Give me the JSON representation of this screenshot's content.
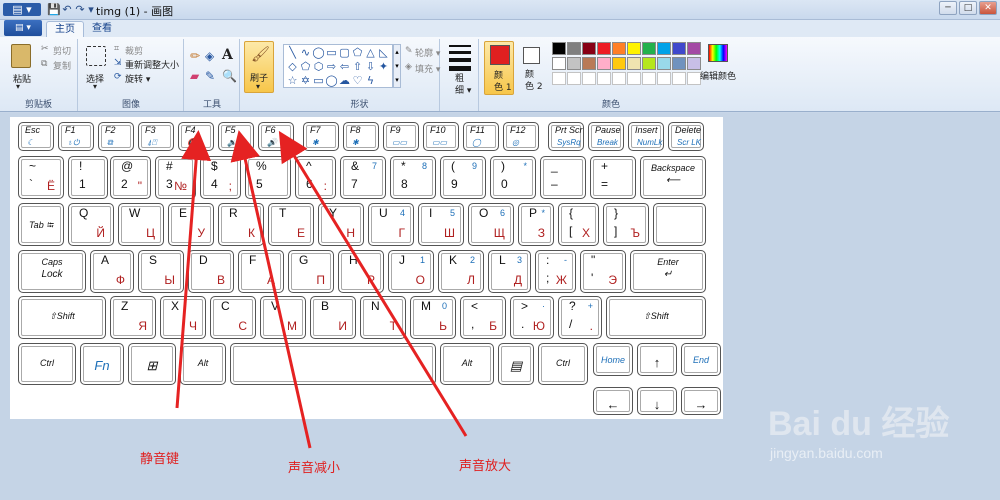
{
  "window": {
    "title": "timg (1) - 画图",
    "app_menu": "▤ ▾",
    "quick_access": [
      "💾",
      "↶",
      "↷",
      "▾"
    ],
    "controls": {
      "minimize": "─",
      "maximize": "□",
      "close": "✕"
    }
  },
  "tabs": [
    {
      "label": "主页",
      "active": true
    },
    {
      "label": "查看",
      "active": false
    }
  ],
  "ribbon": {
    "clipboard": {
      "paste": "粘贴",
      "cut": "剪切",
      "copy": "复制",
      "group": "剪贴板"
    },
    "image": {
      "select": "选择",
      "crop": "裁剪",
      "resize": "重新调整大小",
      "rotate": "旋转 ▾",
      "group": "图像"
    },
    "tools": {
      "group": "工具"
    },
    "brushes": {
      "label": "刷子"
    },
    "shapes": {
      "outline": "轮廓 ▾",
      "fill": "填充 ▾",
      "group": "形状"
    },
    "size": {
      "label": "粗\n细 ▾"
    },
    "colors": {
      "color1": "颜\n色 1",
      "color2": "颜\n色 2",
      "edit": "编辑颜色",
      "group": "颜色",
      "color1_value": "#e02020",
      "color2_value": "#ffffff",
      "palette_row1": [
        "#000000",
        "#7f7f7f",
        "#880015",
        "#ed1c24",
        "#ff7f27",
        "#fff200",
        "#22b14c",
        "#00a2e8",
        "#3f48cc",
        "#a349a4"
      ],
      "palette_row2": [
        "#ffffff",
        "#c3c3c3",
        "#b97a57",
        "#ffaec9",
        "#ffc90e",
        "#efe4b0",
        "#b5e61d",
        "#99d9ea",
        "#7092be",
        "#c8bfe7"
      ]
    }
  },
  "keyboard": {
    "rows": [
      [
        {
          "t": "Esc",
          "b": "☾"
        },
        {
          "t": "F1",
          "b": "♁⏻"
        },
        {
          "t": "F2",
          "b": "⧉"
        },
        {
          "t": "F3",
          "b": "⍋⍞"
        },
        {
          "t": "F4",
          "b": "🔇"
        },
        {
          "t": "F5",
          "b": "🔉"
        },
        {
          "t": "F6",
          "b": "🔊"
        },
        {
          "t": "F7",
          "b": "✱"
        },
        {
          "t": "F8",
          "b": "✱"
        },
        {
          "t": "F9",
          "b": "▭▭"
        },
        {
          "t": "F10",
          "b": "▭▭"
        },
        {
          "t": "F11",
          "b": "◯"
        },
        {
          "t": "F12",
          "b": "◎"
        },
        {
          "t": "Prt Scr",
          "b": "SysRq"
        },
        {
          "t": "Pause",
          "b": "Break"
        },
        {
          "t": "Insert",
          "b": "NumLk"
        },
        {
          "t": "Delete",
          "b": "Scr LK"
        }
      ],
      [
        {
          "t": "~",
          "b": "`",
          "r": "Ё"
        },
        {
          "t": "!",
          "b": "1"
        },
        {
          "t": "@",
          "b": "2",
          "r": "\""
        },
        {
          "t": "#",
          "b": "3",
          "r": "№"
        },
        {
          "t": "$",
          "b": "4",
          "r": ";"
        },
        {
          "t": "%",
          "b": "5"
        },
        {
          "t": "^",
          "b": "6",
          "r": ":"
        },
        {
          "t": "&",
          "b": "7",
          "n": "7"
        },
        {
          "t": "*",
          "b": "8",
          "n": "8"
        },
        {
          "t": "(",
          "b": "9",
          "n": "9"
        },
        {
          "t": ")",
          "b": "0",
          "n": "*"
        },
        {
          "t": "_",
          "b": "–"
        },
        {
          "t": "+",
          "b": "="
        },
        {
          "t": "Backspace",
          "b": "⟵"
        }
      ],
      [
        {
          "t": "Tab ⭾"
        },
        {
          "t": "Q",
          "r": "Й"
        },
        {
          "t": "W",
          "r": "Ц"
        },
        {
          "t": "E",
          "r": "У"
        },
        {
          "t": "R",
          "r": "К"
        },
        {
          "t": "T",
          "r": "Е"
        },
        {
          "t": "Y",
          "r": "Н"
        },
        {
          "t": "U",
          "r": "Г",
          "n": "4"
        },
        {
          "t": "I",
          "r": "Ш",
          "n": "5"
        },
        {
          "t": "O",
          "r": "Щ",
          "n": "6"
        },
        {
          "t": "P",
          "r": "З",
          "n": "*"
        },
        {
          "t": "{",
          "b": "[",
          "r": "Х"
        },
        {
          "t": "}",
          "b": "]",
          "r": "Ъ"
        },
        {
          "t": ""
        }
      ],
      [
        {
          "t": "Caps",
          "b": "Lock"
        },
        {
          "t": "A",
          "r": "Ф"
        },
        {
          "t": "S",
          "r": "Ы"
        },
        {
          "t": "D",
          "r": "В"
        },
        {
          "t": "F",
          "r": "А"
        },
        {
          "t": "G",
          "r": "П"
        },
        {
          "t": "H",
          "r": "Р"
        },
        {
          "t": "J",
          "r": "О",
          "n": "1"
        },
        {
          "t": "K",
          "r": "Л",
          "n": "2"
        },
        {
          "t": "L",
          "r": "Д",
          "n": "3"
        },
        {
          "t": ":",
          "b": ";",
          "r": "Ж",
          "n": "-"
        },
        {
          "t": "\"",
          "b": "'",
          "r": "Э"
        },
        {
          "t": "Enter",
          "b": "↵"
        }
      ],
      [
        {
          "t": "⇧Shift"
        },
        {
          "t": "Z",
          "r": "Я"
        },
        {
          "t": "X",
          "r": "Ч"
        },
        {
          "t": "C",
          "r": "С"
        },
        {
          "t": "V",
          "r": "М"
        },
        {
          "t": "B",
          "r": "И"
        },
        {
          "t": "N",
          "r": "Т"
        },
        {
          "t": "M",
          "r": "Ь",
          "n": "0"
        },
        {
          "t": "<",
          "b": ",",
          "r": "Б"
        },
        {
          "t": ">",
          "b": ".",
          "r": "Ю",
          "n": "·"
        },
        {
          "t": "?",
          "b": "/",
          "r": ".",
          "n": "+"
        },
        {
          "t": "⇧Shift"
        }
      ],
      [
        {
          "t": "Ctrl"
        },
        {
          "t": "Fn"
        },
        {
          "t": "⊞"
        },
        {
          "t": "Alt"
        },
        {
          "t": ""
        },
        {
          "t": "Alt"
        },
        {
          "t": "▤"
        },
        {
          "t": "Ctrl"
        },
        {
          "t": "Home"
        },
        {
          "t": "↑"
        },
        {
          "t": "End"
        }
      ],
      [
        {
          "t": "←"
        },
        {
          "t": "↓"
        },
        {
          "t": "→"
        }
      ]
    ]
  },
  "annotations": {
    "mute": "静音键",
    "vol_down": "声音减小",
    "vol_up": "声音放大"
  },
  "watermark": {
    "brand": "Bai du 经验",
    "url": "jingyan.baidu.com"
  }
}
